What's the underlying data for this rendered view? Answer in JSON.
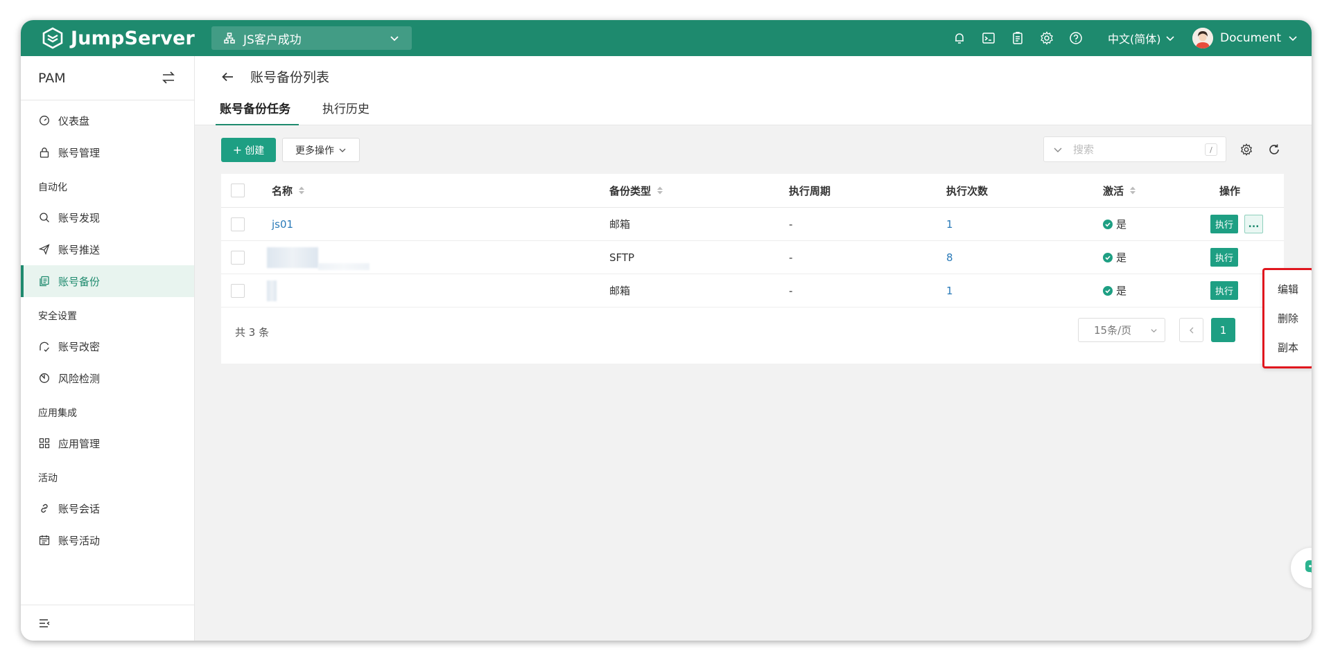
{
  "topbar": {
    "logo_text": "JumpServer",
    "org": "JS客户成功",
    "language": "中文(简体)",
    "user": "Document",
    "icons": [
      "bell-icon",
      "terminal-icon",
      "clipboard-icon",
      "gear-icon",
      "help-icon"
    ]
  },
  "sidebar": {
    "title": "PAM",
    "items": [
      {
        "label": "仪表盘",
        "icon": "dashboard-icon"
      },
      {
        "label": "账号管理",
        "icon": "lock-icon"
      }
    ],
    "groups": {
      "automation": {
        "label": "自动化",
        "items": [
          {
            "label": "账号发现",
            "icon": "search-icon"
          },
          {
            "label": "账号推送",
            "icon": "send-icon"
          },
          {
            "label": "账号备份",
            "icon": "backup-icon",
            "active": true
          }
        ]
      },
      "security": {
        "label": "安全设置",
        "items": [
          {
            "label": "账号改密",
            "icon": "key-change-icon"
          },
          {
            "label": "风险检测",
            "icon": "risk-icon"
          }
        ]
      },
      "integration": {
        "label": "应用集成",
        "items": [
          {
            "label": "应用管理",
            "icon": "apps-icon"
          }
        ]
      },
      "activity": {
        "label": "活动",
        "items": [
          {
            "label": "账号会话",
            "icon": "link-icon"
          },
          {
            "label": "账号活动",
            "icon": "calendar-icon"
          }
        ]
      }
    }
  },
  "header": {
    "title": "账号备份列表",
    "tabs": [
      {
        "label": "账号备份任务",
        "active": true
      },
      {
        "label": "执行历史",
        "active": false
      }
    ]
  },
  "toolbar": {
    "create_label": "创建",
    "more_label": "更多操作",
    "search_placeholder": "搜索",
    "search_shortcut": "/"
  },
  "table": {
    "columns": [
      "名称",
      "备份类型",
      "执行周期",
      "执行次数",
      "激活",
      "操作"
    ],
    "rows": [
      {
        "name": "js01",
        "type": "邮箱",
        "period": "-",
        "count": "1",
        "active": "是",
        "run": "执行",
        "more": "..."
      },
      {
        "name": "",
        "type": "SFTP",
        "period": "-",
        "count": "8",
        "active": "是",
        "run": "执行"
      },
      {
        "name": "",
        "type": "邮箱",
        "period": "-",
        "count": "1",
        "active": "是",
        "run": "执行"
      }
    ]
  },
  "footer": {
    "total": "共 3 条",
    "page_size": "15条/页",
    "current_page": "1"
  },
  "dropdown": {
    "items": [
      "编辑",
      "删除",
      "副本"
    ]
  },
  "colors": {
    "brand": "#1e8a6e",
    "button": "#1e9f83",
    "link": "#2a7ab8",
    "highlight": "#e0161e"
  }
}
